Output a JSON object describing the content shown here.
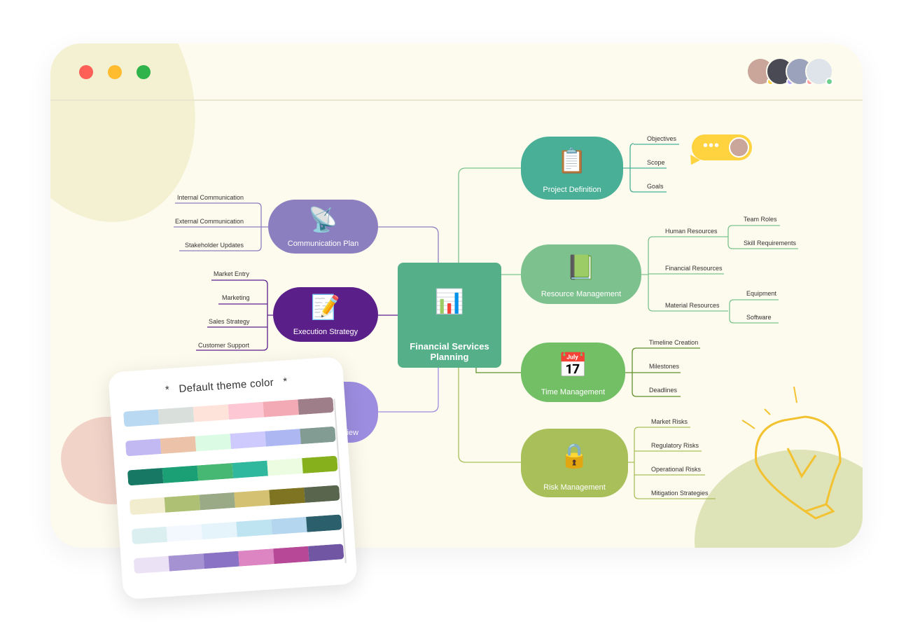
{
  "window": {
    "controls": [
      {
        "name": "close",
        "color": "#fe5f57"
      },
      {
        "name": "minimize",
        "color": "#febc2e"
      },
      {
        "name": "maximize",
        "color": "#2fb34a"
      }
    ]
  },
  "collaborators": [
    {
      "color": "#c9a59a",
      "status": "#ffd23f"
    },
    {
      "color": "#4a4a55",
      "status": "#b6a6f7"
    },
    {
      "color": "#9aa3bb",
      "status": "#ff9ea3"
    },
    {
      "color": "#dfe3ea",
      "status": "#6fcf8f"
    }
  ],
  "mindmap": {
    "center": {
      "label": "Financial Services Planning",
      "color": "#55b08a",
      "icon": "chart-growth-icon"
    },
    "branches": [
      {
        "label": "Project Definition",
        "color": "#4aaf97",
        "icon": "checklist-icon",
        "children": [
          "Objectives",
          "Scope",
          "Goals"
        ]
      },
      {
        "label": "Resource Management",
        "color": "#7dc18e",
        "icon": "book-icon",
        "children": [
          "Human Resources",
          "Team Roles",
          "Skill Requirements",
          "Financial Resources",
          "Material Resources",
          "Equipment",
          "Software"
        ]
      },
      {
        "label": "Time Management",
        "color": "#72bf66",
        "icon": "calendar-clock-icon",
        "children": [
          "Timeline Creation",
          "Milestones",
          "Deadlines"
        ]
      },
      {
        "label": "Risk Management",
        "color": "#a8bf5a",
        "icon": "shield-lock-icon",
        "children": [
          "Market Risks",
          "Regulatory Risks",
          "Operational Risks",
          "Mitigation Strategies"
        ]
      },
      {
        "label": "Communication Plan",
        "color": "#8b7fc0",
        "icon": "router-icon",
        "children": [
          "Internal Communication",
          "External Communication",
          "Stakeholder Updates"
        ]
      },
      {
        "label": "Execution Strategy",
        "color": "#5b1f8a",
        "icon": "notepad-icon",
        "children": [
          "Market Entry",
          "Marketing",
          "Sales Strategy",
          "Customer Support"
        ]
      },
      {
        "label": "iew",
        "color": "#9d8de0"
      }
    ]
  },
  "theme_card": {
    "title": "Default theme color",
    "asterisk": "*",
    "palettes": [
      [
        "#b9d8f2",
        "#d9dfdb",
        "#fde3da",
        "#fdc7d4",
        "#f3aab5",
        "#9e7f89"
      ],
      [
        "#c3b9f2",
        "#ecc3a8",
        "#dbfbe4",
        "#cfcafd",
        "#adb7f2",
        "#829c94"
      ],
      [
        "#177864",
        "#1b9f75",
        "#47b873",
        "#30b89e",
        "#ebfce1",
        "#86b11c"
      ],
      [
        "#f3edd0",
        "#adc074",
        "#9aa986",
        "#d5c172",
        "#7e7421",
        "#5a654d"
      ],
      [
        "#dceff0",
        "#f2f8fd",
        "#e5f4fb",
        "#bee4f2",
        "#b4d6ee",
        "#2a5f6b"
      ],
      [
        "#ece2f5",
        "#a592d3",
        "#8a73c4",
        "#dd85c3",
        "#b64897",
        "#7157a3"
      ]
    ]
  }
}
